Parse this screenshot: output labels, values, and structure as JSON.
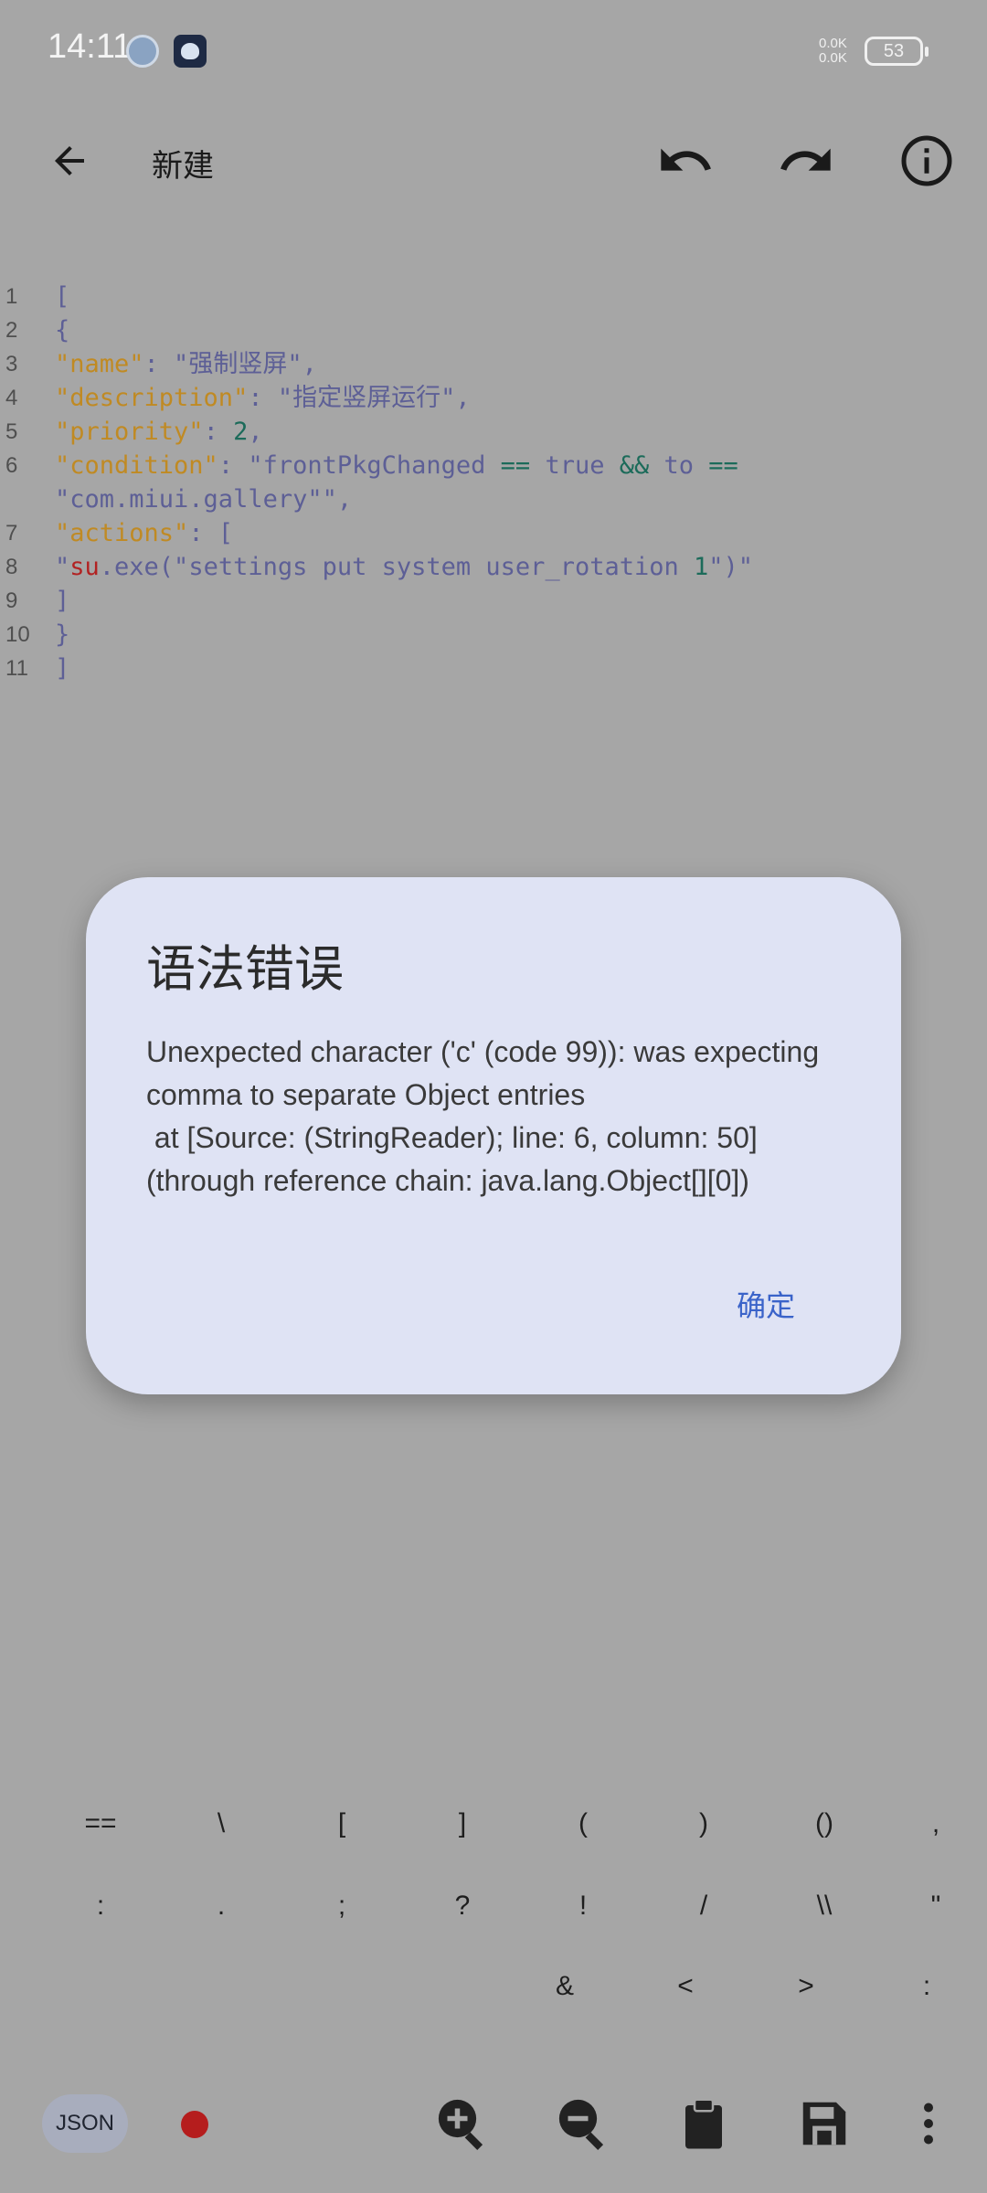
{
  "status_bar": {
    "time": "14:11",
    "net_speed_up": "0.0K",
    "net_speed_down": "0.0K",
    "battery": "53"
  },
  "toolbar": {
    "title": "新建",
    "icons": [
      "back-arrow-icon",
      "undo-icon",
      "redo-icon",
      "info-icon"
    ]
  },
  "editor": {
    "line_numbers": [
      "1",
      "2",
      "3",
      "4",
      "5",
      "6",
      "",
      "7",
      "8",
      "9",
      "10",
      "11"
    ],
    "tokens": {
      "l1": "[",
      "l2": "{",
      "l3_key": "\"name\"",
      "l3_rest": ": \"强制竖屏\",",
      "l4_key": "\"description\"",
      "l4_rest": ": \"指定竖屏运行\",",
      "l5_key": "\"priority\"",
      "l5_colon": ": ",
      "l5_num": "2",
      "l5_comma": ",",
      "l6_key": "\"condition\"",
      "l6_a": ": \"frontPkgChanged ",
      "l6_op1": "==",
      "l6_b": " true ",
      "l6_op2": "&&",
      "l6_c": " to ",
      "l6_op3": "==",
      "l6w": "\"com.miui.gallery\"\",",
      "l7_key": "\"actions\"",
      "l7_rest": ": [",
      "l8_q": "\"",
      "l8_su": "su",
      "l8_a": ".exe(\"settings put system user_rotation ",
      "l8_num": "1",
      "l8_b": "\")\"",
      "l9": "]",
      "l10": "}",
      "l11": "]"
    }
  },
  "dialog": {
    "title": "语法错误",
    "message": "Unexpected character ('c' (code 99)): was expecting comma to separate Object entries\n at [Source: (StringReader); line: 6, column: 50] (through reference chain: java.lang.Object[][0])",
    "ok_label": "确定"
  },
  "symbol_keys": {
    "row1": [
      "==",
      "\\",
      "[",
      "]",
      "(",
      ")",
      "()",
      ","
    ],
    "row2": [
      ":",
      ".",
      ";",
      "?",
      "!",
      "/",
      "\\\\",
      "\""
    ],
    "row3": [
      "&",
      "<",
      ">",
      ":"
    ]
  },
  "bottom_bar": {
    "json_label": "JSON",
    "icons": [
      "record-icon",
      "zoom-in-icon",
      "zoom-out-icon",
      "clipboard-icon",
      "save-icon",
      "more-vertical-icon"
    ]
  },
  "colors": {
    "background": "#a6a6a6",
    "dialog": "#dfe3f4",
    "accent": "#3a63c9",
    "json_key": "#c08a23",
    "string": "#5d5f96",
    "number": "#1c6b5a",
    "record": "#b51d1d"
  }
}
